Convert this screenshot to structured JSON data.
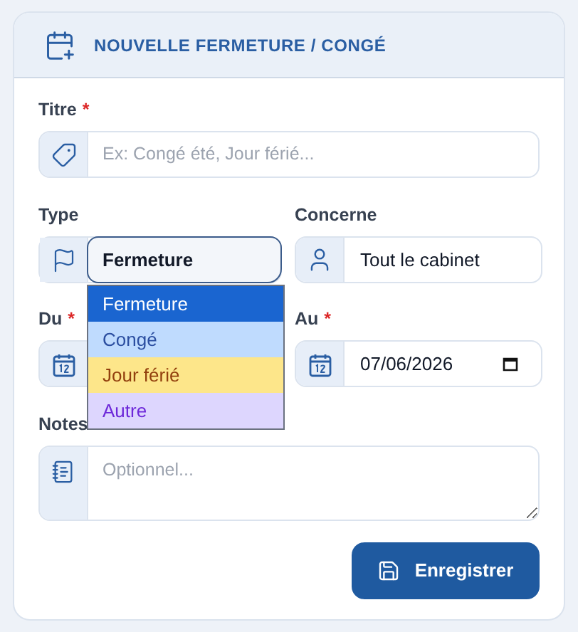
{
  "header": {
    "title": "NOUVELLE FERMETURE / CONGÉ"
  },
  "title_field": {
    "label": "Titre",
    "required_mark": "*",
    "placeholder": "Ex: Congé été, Jour férié..."
  },
  "type_field": {
    "label": "Type",
    "value": "Fermeture",
    "expanded": true,
    "options": [
      {
        "label": "Fermeture",
        "kind": "closure",
        "selected": true
      },
      {
        "label": "Congé",
        "kind": "leave",
        "selected": false
      },
      {
        "label": "Jour férié",
        "kind": "holiday",
        "selected": false
      },
      {
        "label": "Autre",
        "kind": "other",
        "selected": false
      }
    ]
  },
  "concerne_field": {
    "label": "Concerne",
    "value": "Tout le cabinet"
  },
  "du_field": {
    "label": "Du",
    "required_mark": "*"
  },
  "au_field": {
    "label": "Au",
    "required_mark": "*",
    "value": "07/06/2026"
  },
  "notes_field": {
    "label": "Notes",
    "placeholder": "Optionnel..."
  },
  "save_button": {
    "label": "Enregistrer"
  }
}
